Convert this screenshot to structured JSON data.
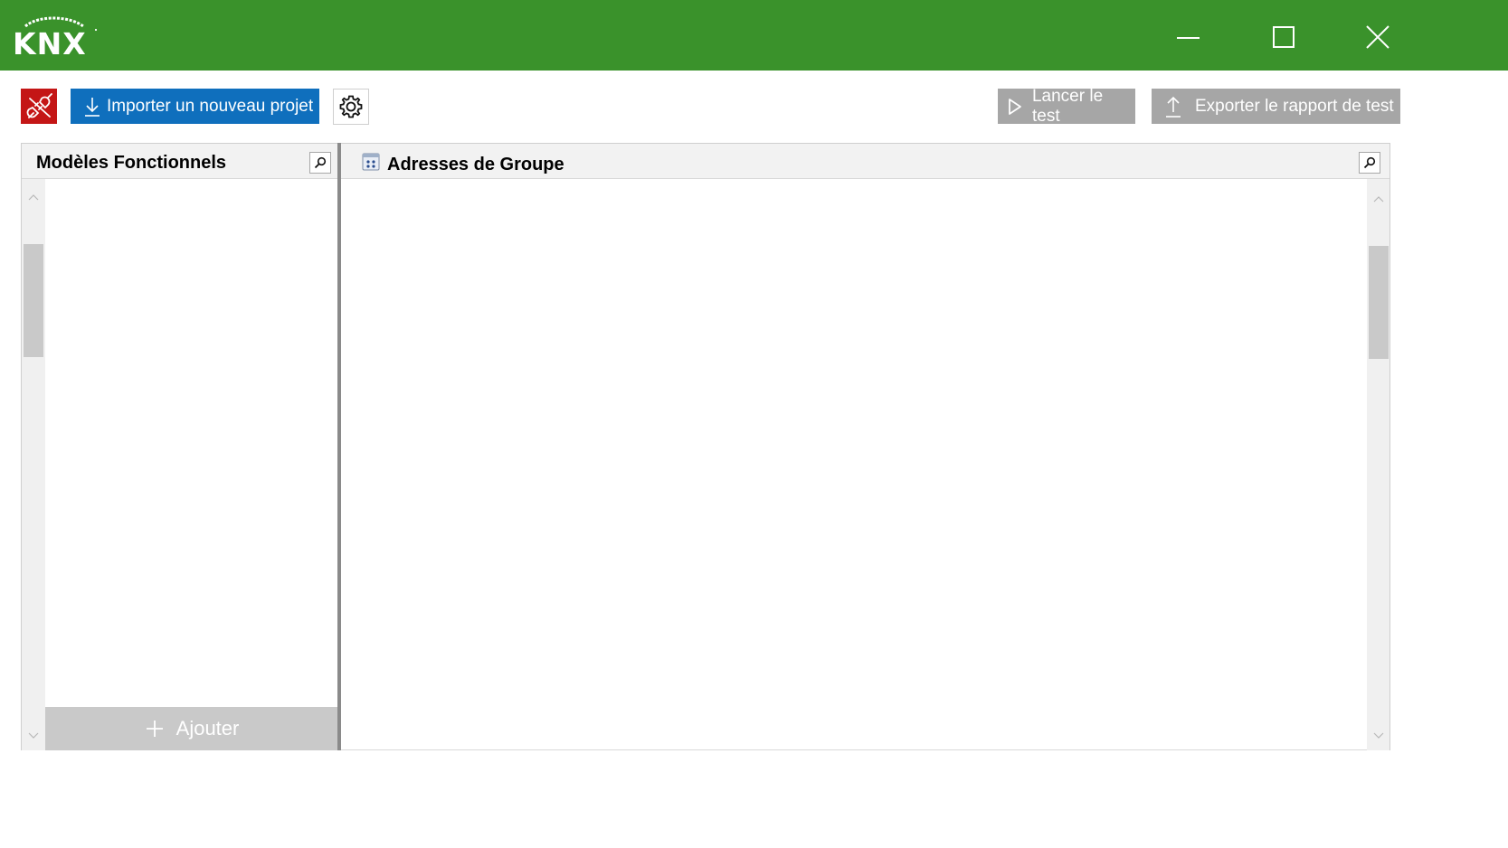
{
  "app": {
    "logo_text": "KNX",
    "title_bar_color": "#3a922b"
  },
  "window_controls": {
    "minimize_icon": "minimize-icon",
    "maximize_icon": "maximize-icon",
    "close_icon": "close-icon"
  },
  "toolbar": {
    "disconnect_icon": "plug-disconnected-icon",
    "import_label": "Importer un nouveau projet",
    "settings_icon": "gear-icon",
    "run_test_label": "Lancer le test",
    "export_label": "Exporter le rapport de test",
    "accent_color": "#0f6fbd",
    "disconnect_color": "#c41616",
    "disabled_color": "#a6a6a6"
  },
  "left_panel": {
    "title": "Modèles Fonctionnels",
    "items": [],
    "add_label": "Ajouter"
  },
  "right_panel": {
    "title": "Adresses de Groupe",
    "items": []
  }
}
